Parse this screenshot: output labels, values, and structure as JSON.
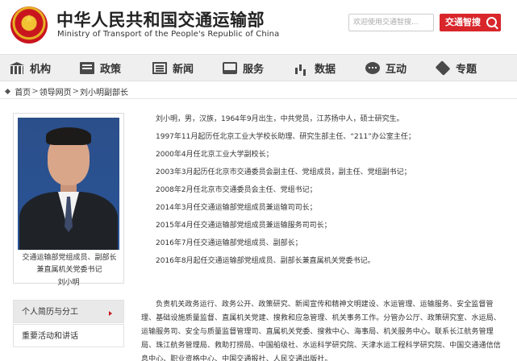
{
  "header": {
    "title_cn": "中华人民共和国交通运输部",
    "title_en": "Ministry of Transport of the People's Republic of China",
    "search_placeholder": "欢迎使用交通智搜...",
    "smart_search_label": "交通智搜",
    "emblem_icon": "national-emblem-icon",
    "search_icon": "magnifier-icon"
  },
  "nav": {
    "items": [
      {
        "label": "机构",
        "icon": "institution-icon"
      },
      {
        "label": "政策",
        "icon": "policy-icon"
      },
      {
        "label": "新闻",
        "icon": "news-icon"
      },
      {
        "label": "服务",
        "icon": "service-icon"
      },
      {
        "label": "数据",
        "icon": "data-icon"
      },
      {
        "label": "互动",
        "icon": "interaction-icon"
      },
      {
        "label": "专题",
        "icon": "topic-icon"
      }
    ]
  },
  "breadcrumb": {
    "items": [
      "首页",
      "领导网页",
      "刘小明副部长"
    ],
    "separator": ">"
  },
  "profile": {
    "caption_line1": "交通运输部党组成员、副部长",
    "caption_line2": "兼直属机关党委书记",
    "name": "刘小明"
  },
  "side_menu": {
    "items": [
      {
        "label": "个人简历与分工",
        "active": true
      },
      {
        "label": "重要活动和讲话",
        "active": false
      }
    ]
  },
  "bio": {
    "lines": [
      "刘小明，男，汉族，1964年9月出生，中共党员，江苏扬中人，硕士研究生。",
      "1997年11月起历任北京工业大学校长助理、研究生部主任、“211”办公室主任；",
      "2000年4月任北京工业大学副校长；",
      "2003年3月起历任北京市交通委员会副主任、党组成员，副主任、党组副书记；",
      "2008年2月任北京市交通委员会主任、党组书记；",
      "2014年3月任交通运输部党组成员兼运输司司长；",
      "2015年4月任交通运输部党组成员兼运输服务司司长；",
      "2016年7月任交通运输部党组成员、副部长；",
      "2016年8月起任交通运输部党组成员、副部长兼直属机关党委书记。"
    ],
    "duties": "负责机关政务运行、政务公开、政策研究、新闻宣传和精神文明建设、水运管理、运输服务、安全监督管理、基础设施质量监督、直属机关党建、搜救和应急管理、机关事务工作。分管办公厅、政策研究室、水运局、运输服务司、安全与质量监督管理司、直属机关党委、搜救中心、海事局、机关服务中心。联系长江航务管理局、珠江航务管理局、救助打捞局、中国船级社、水运科学研究院、天津水运工程科学研究院、中国交通通信信息中心、职业资格中心、中国交通报社、人民交通出版社。"
  },
  "colors": {
    "accent_red": "#d8262a",
    "nav_bg": "#efefef"
  }
}
